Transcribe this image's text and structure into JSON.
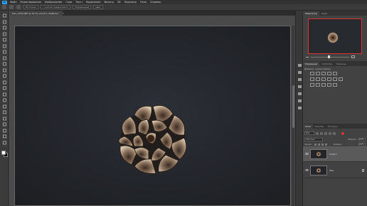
{
  "app": {
    "logo": "Ps"
  },
  "menu": [
    "Файл",
    "Редактирование",
    "Изображение",
    "Слои",
    "Текст",
    "Выделение",
    "Фильтр",
    "3D",
    "Просмотр",
    "Окно",
    "Справка"
  ],
  "options_bar": {
    "field1": "Источник",
    "field2": "с учетом содержимого",
    "field3": "Нормальный",
    "field4": "Цвет"
  },
  "document": {
    "tab_title": "DSC_0744.NEF @ 16,7% (Слой 1, RGB/16) *",
    "close": "×"
  },
  "navigator": {
    "tabs": [
      "Навигатор",
      "Инфо"
    ]
  },
  "adjustments": {
    "tabs": [
      "Коррекция",
      "Свойства",
      "Образцы"
    ],
    "hint": "Добавить корректировку"
  },
  "layers": {
    "tabs": [
      "Слои",
      "Каналы",
      "Контуры"
    ],
    "kind_filter": "Вид",
    "blend_mode": "Обычные",
    "opacity_label": "Непрозр.:",
    "opacity": "100%",
    "lock_label": "Закреп.:",
    "fill_label": "Заливка:",
    "fill": "100%",
    "items": [
      {
        "name": "Слой 1",
        "active": true
      },
      {
        "name": "Фон",
        "active": false
      }
    ]
  },
  "colors": {
    "accent": "#31a8ff",
    "highlight": "#dd3333"
  }
}
